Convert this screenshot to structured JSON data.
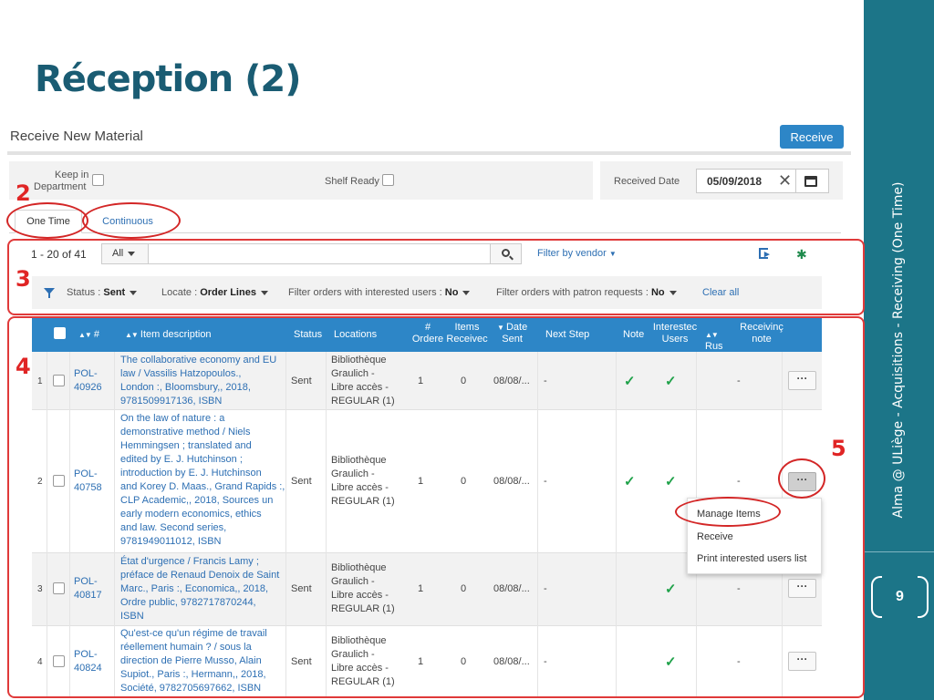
{
  "slide": {
    "title": "Réception (2)",
    "side_caption": "Alma @ ULiège - Acquisitions - Receiving (One Time)",
    "page_number": "9"
  },
  "header": {
    "title": "Receive New Material",
    "receive_label": "Receive"
  },
  "options": {
    "keep_in_department_label_1": "Keep in",
    "keep_in_department_label_2": "Department",
    "shelf_ready_label": "Shelf Ready",
    "received_date_label": "Received Date",
    "received_date_value": "05/09/2018"
  },
  "tabs": [
    {
      "label": "One Time",
      "active": true
    },
    {
      "label": "Continuous",
      "active": false
    }
  ],
  "toolbar": {
    "count": "1 - 20 of 41",
    "scope": "All",
    "search_value": "",
    "filter_vendor": "Filter by vendor"
  },
  "filters": {
    "status_label": "Status :",
    "status_value": "Sent",
    "locate_label": "Locate :",
    "locate_value": "Order Lines",
    "interested_label": "Filter orders with interested users :",
    "interested_value": "No",
    "patron_label": "Filter orders with patron requests :",
    "patron_value": "No",
    "clear_all": "Clear all"
  },
  "table": {
    "columns": {
      "number": "#",
      "item_description": "Item description",
      "status": "Status",
      "locations": "Locations",
      "ordered_1": "#",
      "ordered_2": "Ordere",
      "items_received_1": "Items",
      "items_received_2": "Receivec",
      "date_sent_1": "Date",
      "date_sent_2": "Sent",
      "next_step": "Next Step",
      "note": "Note",
      "interested_1": "Interestec",
      "interested_2": "Users",
      "rush": "Rus",
      "receiving_note_1": "Receivinç",
      "receiving_note_2": "note"
    },
    "rows": [
      {
        "index": "1",
        "pol_1": "POL-",
        "pol_2": "40926",
        "description": [
          "The collaborative economy and EU",
          "law / Vassilis Hatzopoulos.,",
          "London :, Bloomsbury,, 2018,",
          "9781509917136, ISBN"
        ],
        "status": "Sent",
        "location": [
          "Bibliothèque",
          "Graulich -",
          "Libre accès -",
          "REGULAR (1)"
        ],
        "ordered": "1",
        "received": "0",
        "date_sent": "08/08/...",
        "next_step": "-",
        "note": true,
        "interested": true,
        "receiving_note": "-"
      },
      {
        "index": "2",
        "pol_1": "POL-",
        "pol_2": "40758",
        "description": [
          "On the law of nature : a",
          "demonstrative method / Niels",
          "Hemmingsen ; translated and",
          "edited by E. J. Hutchinson ;",
          "introduction by E. J. Hutchinson",
          "and Korey D. Maas., Grand Rapids :,",
          "CLP Academic,, 2018, Sources un",
          "early modern economics, ethics",
          "and law. Second series,",
          "9781949011012, ISBN"
        ],
        "status": "Sent",
        "location": [
          "Bibliothèque",
          "Graulich -",
          "Libre accès -",
          "REGULAR (1)"
        ],
        "ordered": "1",
        "received": "0",
        "date_sent": "08/08/...",
        "next_step": "-",
        "note": true,
        "interested": true,
        "receiving_note": "-"
      },
      {
        "index": "3",
        "pol_1": "POL-",
        "pol_2": "40817",
        "description": [
          "État d'urgence / Francis Lamy ;",
          "préface de Renaud Denoix de Saint",
          "Marc., Paris :, Economica,, 2018,",
          "Ordre public, 9782717870244,",
          "ISBN"
        ],
        "status": "Sent",
        "location": [
          "Bibliothèque",
          "Graulich -",
          "Libre accès -",
          "REGULAR (1)"
        ],
        "ordered": "1",
        "received": "0",
        "date_sent": "08/08/...",
        "next_step": "-",
        "note": false,
        "interested": true,
        "receiving_note": "-"
      },
      {
        "index": "4",
        "pol_1": "POL-",
        "pol_2": "40824",
        "description": [
          "Qu'est-ce qu'un régime de travail",
          "réellement humain ? / sous la",
          "direction de Pierre Musso, Alain",
          "Supiot., Paris :, Hermann,, 2018,",
          "Société, 9782705697662, ISBN"
        ],
        "status": "Sent",
        "location": [
          "Bibliothèque",
          "Graulich -",
          "Libre accès -",
          "REGULAR (1)"
        ],
        "ordered": "1",
        "received": "0",
        "date_sent": "08/08/...",
        "next_step": "-",
        "note": false,
        "interested": true,
        "receiving_note": "-"
      }
    ]
  },
  "context_menu": {
    "items": [
      "Manage Items",
      "Receive",
      "Print interested users list"
    ]
  },
  "annotations": {
    "n2": "2",
    "n3": "3",
    "n4": "4",
    "n5": "5"
  },
  "colors": {
    "band": "#1c7588",
    "title": "#1a5c73",
    "primary": "#2d86c7",
    "annotation": "#e03a3a",
    "check": "#20a24a"
  }
}
